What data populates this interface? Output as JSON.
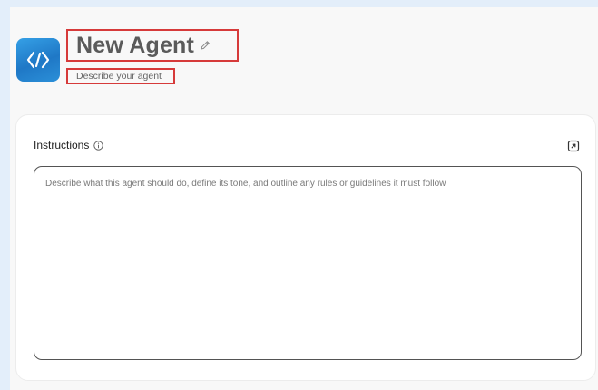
{
  "agent": {
    "name": "New Agent",
    "description_placeholder": "Describe your agent"
  },
  "instructions": {
    "label": "Instructions",
    "placeholder": "Describe what this agent should do, define its tone, and outline any rules or guidelines it must follow"
  },
  "icons": {
    "avatar": "agent-code-icon",
    "edit": "pencil-icon",
    "info": "info-icon",
    "expand": "expand-icon"
  },
  "colors": {
    "background": "#e3eefa",
    "avatar_gradient_start": "#35a0e6",
    "avatar_gradient_end": "#1f78c6",
    "highlight_border": "#d63a3a",
    "title_text": "#5a5a5a"
  }
}
